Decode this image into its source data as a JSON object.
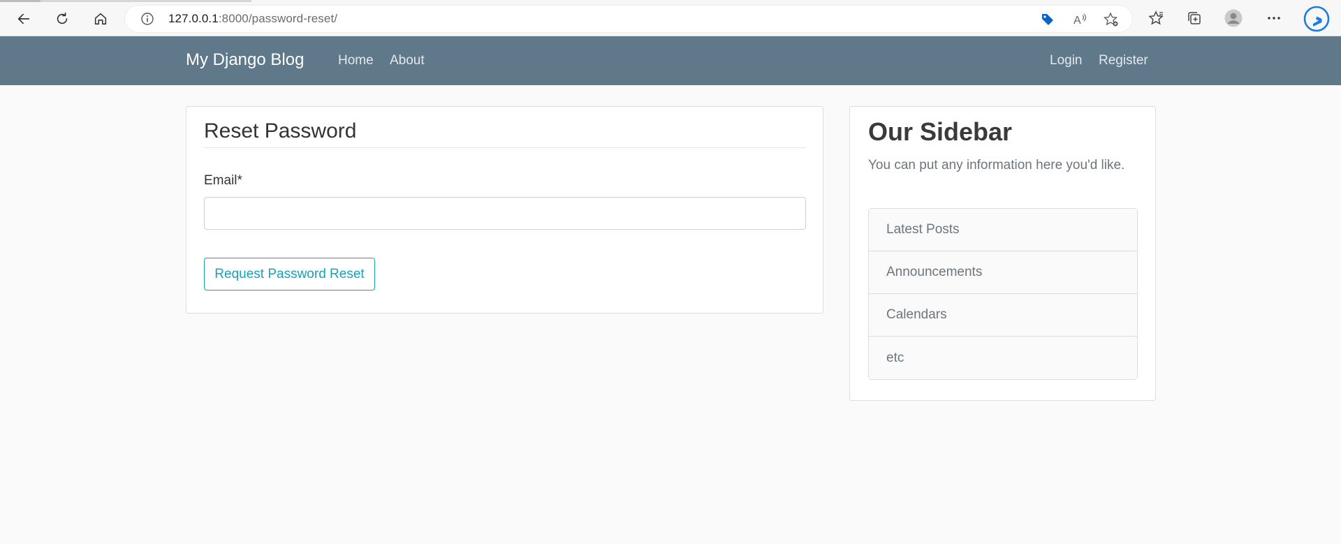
{
  "browser": {
    "url_host": "127.0.0.1",
    "url_rest": ":8000/password-reset/",
    "icons": [
      "back-icon",
      "refresh-icon",
      "home-icon",
      "site-info-icon",
      "shopping-tag-icon",
      "read-aloud-icon",
      "add-favorite-icon",
      "favorites-icon",
      "collections-icon",
      "profile-icon",
      "more-icon",
      "bing-icon"
    ]
  },
  "navbar": {
    "brand": "My Django Blog",
    "left_links": [
      "Home",
      "About"
    ],
    "right_links": [
      "Login",
      "Register"
    ],
    "bg_color": "#5f788a"
  },
  "form": {
    "legend": "Reset Password",
    "email_label": "Email*",
    "email_value": "",
    "submit_label": "Request Password Reset",
    "accent_color": "#17a2b8"
  },
  "sidebar": {
    "title": "Our Sidebar",
    "text": "You can put any information here you'd like.",
    "items": [
      "Latest Posts",
      "Announcements",
      "Calendars",
      "etc"
    ]
  }
}
